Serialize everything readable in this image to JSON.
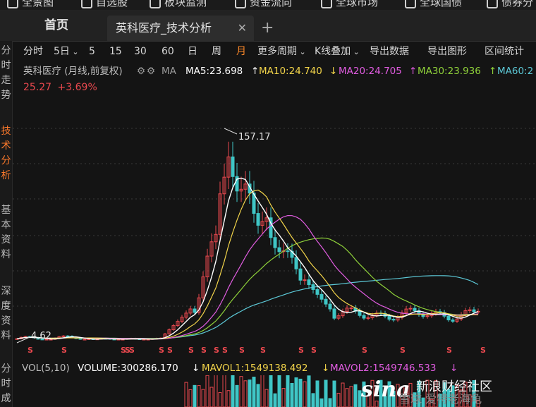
{
  "top_nav": [
    "全景图",
    "自选股",
    "板块监测",
    "资金流向",
    "全球市场",
    "全球国债",
    "债券分"
  ],
  "tabs": {
    "home": "首页",
    "doc": "英科医疗_技术分析",
    "close_symbol": "✕",
    "add_symbol": "+"
  },
  "left_nav": [
    {
      "label": "分时走势",
      "active": false
    },
    {
      "label": "技术分析",
      "active": true
    },
    {
      "label": "基本资料",
      "active": false
    },
    {
      "label": "深度资料",
      "active": false
    },
    {
      "label": "分时成",
      "active": false
    }
  ],
  "toolbar": [
    "分时",
    "5日",
    "5",
    "15",
    "30",
    "60",
    "日",
    "周",
    "月",
    "更多周期",
    "K线叠加",
    "导出数据",
    "导出图形",
    "区间统计"
  ],
  "toolbar_active": "月",
  "info": {
    "stock_label": "英科医疗 (月线,前复权)",
    "gear_icon": "⚙",
    "ma_label": "MA",
    "ma5": "MA5:23.698",
    "ma5_arrow": "↑",
    "ma10": "MA10:24.740",
    "ma10_arrow": "↓",
    "ma20": "MA20:24.705",
    "ma20_arrow": "↑",
    "ma30": "MA30:23.936",
    "ma30_arrow": "↑",
    "ma60": "MA60:2"
  },
  "price": {
    "last": "25.27",
    "change": "+3.69%"
  },
  "annotations": {
    "high": "157.17",
    "low": "4.62",
    "marker": "S"
  },
  "volume": {
    "title": "VOL(5,10)",
    "volume": "VOLUME:300286.170",
    "volume_arrow": "↓",
    "mavol1": "MAVOL1:1549138.492",
    "mavol1_arrow": "↓",
    "mavol2": "MAVOL2:1549746.533",
    "mavol2_arrow": "↓"
  },
  "watermark": {
    "logo": "sina",
    "brand": "新浪财经社区",
    "sub": "雪球 爱特老海龟"
  },
  "colors": {
    "up": "#e9484e",
    "down": "#3fc6c6",
    "ma5": "#ffffff",
    "ma10": "#f2d44a",
    "ma20": "#e05ce0",
    "ma30": "#8fd13a",
    "ma60": "#5cc8d6",
    "accent": "#ff8a2a"
  },
  "chart_data": {
    "type": "candlestick",
    "period": "monthly",
    "price_range": [
      4.62,
      157.17
    ],
    "high_label": 157.17,
    "low_label": 4.62,
    "latest_close": 25.27,
    "change_pct": 3.69,
    "moving_averages": {
      "MA5": 23.698,
      "MA10": 24.74,
      "MA20": 24.705,
      "MA30": 23.936
    },
    "volume_indicators": {
      "VOLUME": 300286.17,
      "MAVOL1": 1549138.492,
      "MAVOL2": 1549746.533
    }
  }
}
